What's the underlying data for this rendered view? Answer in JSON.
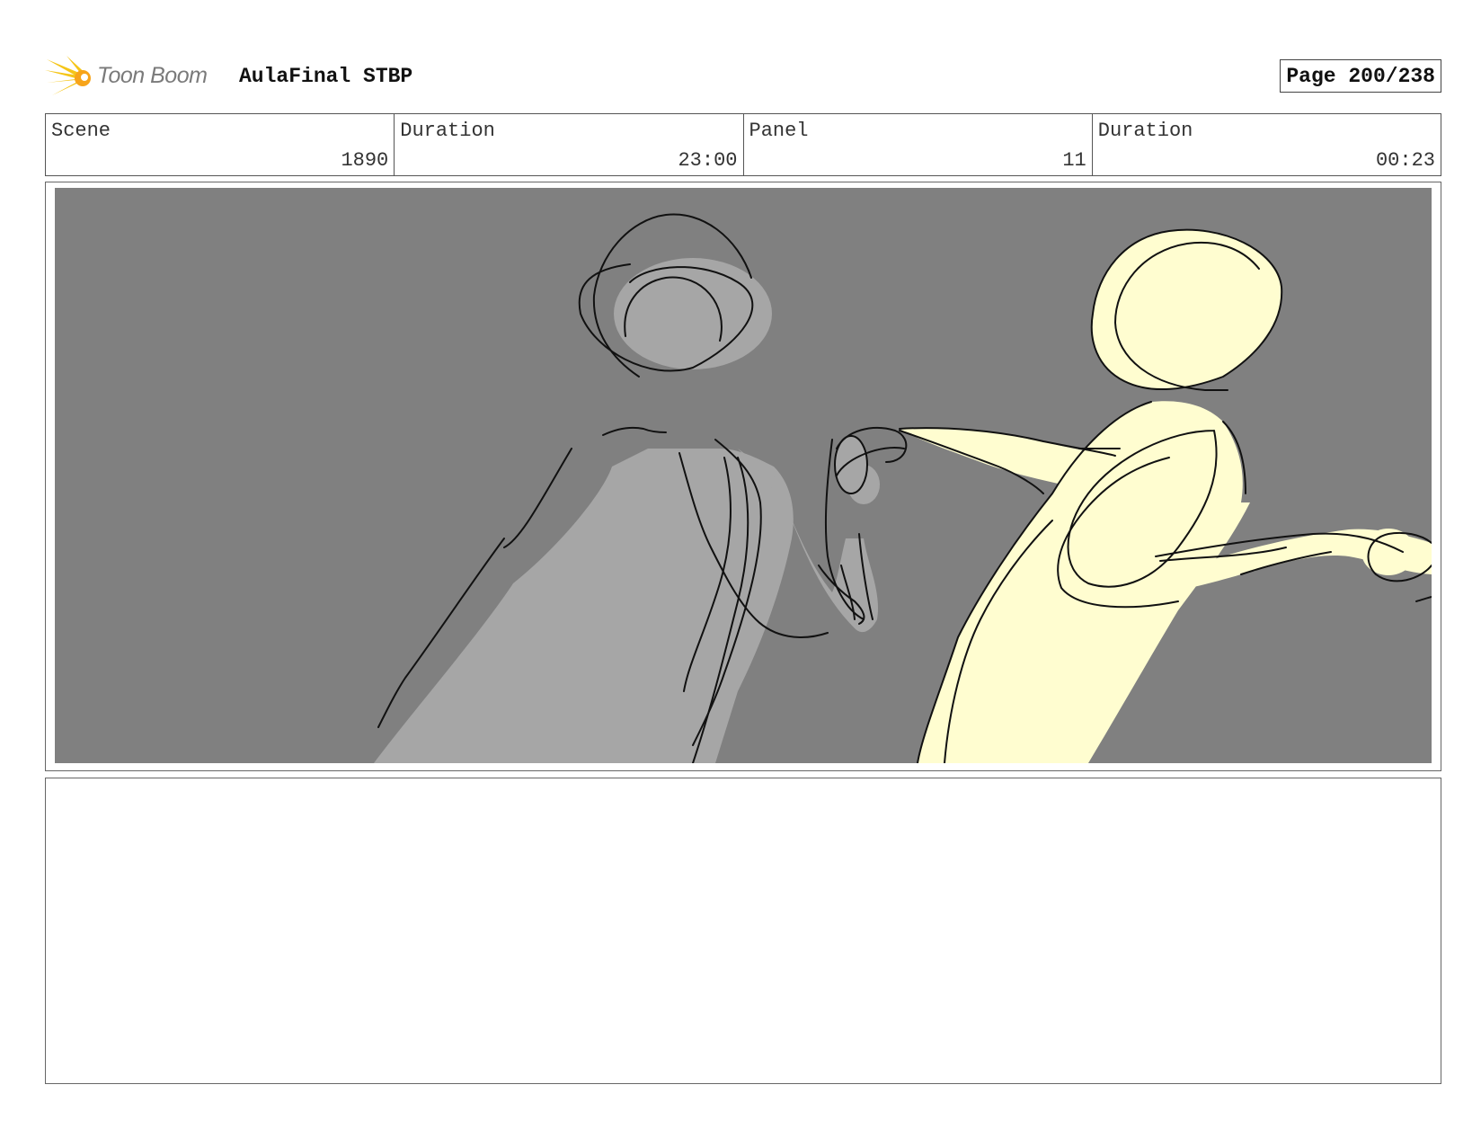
{
  "header": {
    "logo_text": "Toon Boom",
    "project_title": "AulaFinal STBP",
    "page_label": "Page 200/238"
  },
  "info": [
    {
      "label": "Scene",
      "value": "1890"
    },
    {
      "label": "Duration",
      "value": "23:00"
    },
    {
      "label": "Panel",
      "value": "11"
    },
    {
      "label": "Duration",
      "value": "00:23"
    }
  ],
  "panel": {
    "background_color": "#808080",
    "figure_left_color": "#a6a6a6",
    "figure_right_color": "#fffdd0",
    "line_color": "#111111"
  },
  "notes": {
    "text": ""
  }
}
